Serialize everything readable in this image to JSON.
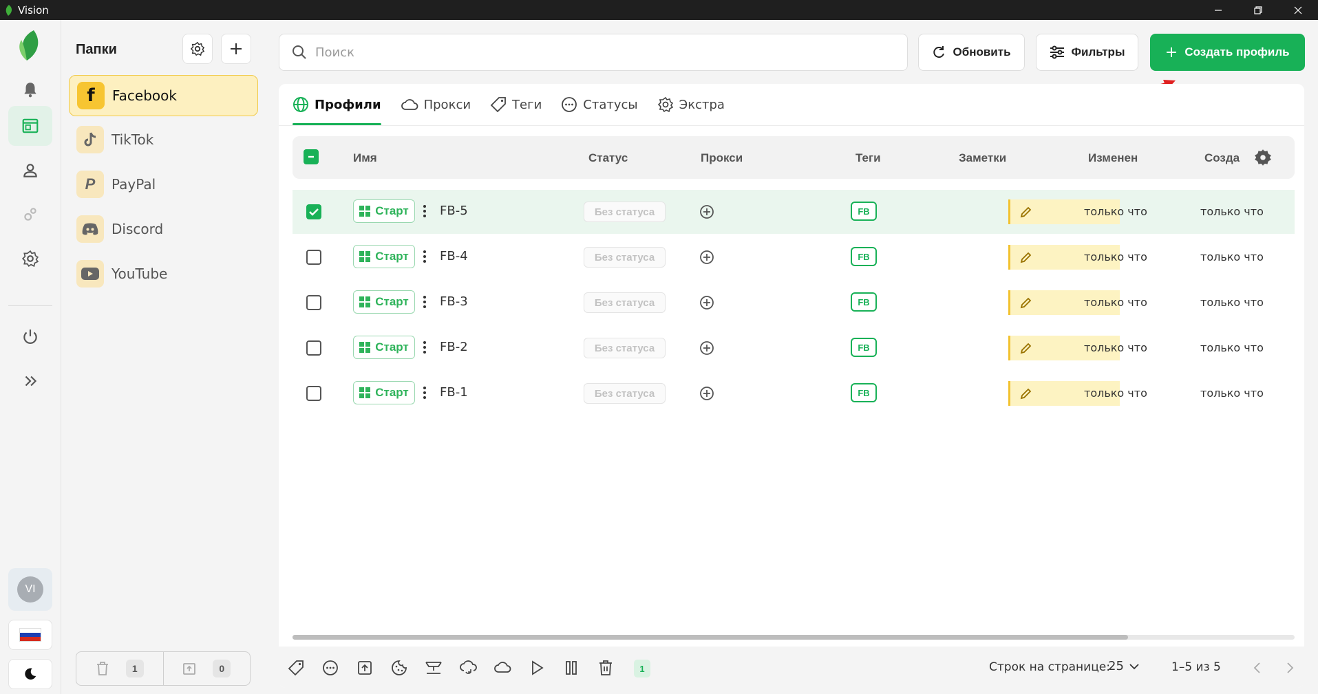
{
  "window": {
    "title": "Vision"
  },
  "folders": {
    "header": "Папки",
    "items": [
      {
        "label": "Facebook",
        "icon": "facebook-icon",
        "active": true
      },
      {
        "label": "TikTok",
        "icon": "tiktok-icon",
        "active": false
      },
      {
        "label": "PayPal",
        "icon": "paypal-icon",
        "active": false
      },
      {
        "label": "Discord",
        "icon": "discord-icon",
        "active": false
      },
      {
        "label": "YouTube",
        "icon": "youtube-icon",
        "active": false
      }
    ],
    "trash_count": "1",
    "archive_count": "0"
  },
  "user": {
    "initials": "VI"
  },
  "search": {
    "placeholder": "Поиск",
    "value": ""
  },
  "toolbar": {
    "refresh_label": "Обновить",
    "filters_label": "Фильтры",
    "create_label": "Создать профиль"
  },
  "tabs": [
    {
      "label": "Профили",
      "icon": "globe-icon",
      "active": true
    },
    {
      "label": "Прокси",
      "icon": "cloud-icon",
      "active": false
    },
    {
      "label": "Теги",
      "icon": "tag-icon",
      "active": false
    },
    {
      "label": "Статусы",
      "icon": "dots-circle-icon",
      "active": false
    },
    {
      "label": "Экстра",
      "icon": "gear-icon",
      "active": false
    }
  ],
  "table": {
    "columns": {
      "name": "Имя",
      "status": "Статус",
      "proxy": "Прокси",
      "tags": "Теги",
      "notes": "Заметки",
      "modified": "Изменен",
      "created": "Созда"
    },
    "rows": [
      {
        "name": "FB-5",
        "start_label": "Старт",
        "status": "Без статуса",
        "tag": "FB",
        "modified": "только что",
        "created": "только что",
        "selected": true
      },
      {
        "name": "FB-4",
        "start_label": "Старт",
        "status": "Без статуса",
        "tag": "FB",
        "modified": "только что",
        "created": "только что",
        "selected": false
      },
      {
        "name": "FB-3",
        "start_label": "Старт",
        "status": "Без статуса",
        "tag": "FB",
        "modified": "только что",
        "created": "только что",
        "selected": false
      },
      {
        "name": "FB-2",
        "start_label": "Старт",
        "status": "Без статуса",
        "tag": "FB",
        "modified": "только что",
        "created": "только что",
        "selected": false
      },
      {
        "name": "FB-1",
        "start_label": "Старт",
        "status": "Без статуса",
        "tag": "FB",
        "modified": "только что",
        "created": "только что",
        "selected": false
      }
    ]
  },
  "footer": {
    "selected_count": "1",
    "rows_per_page_label": "Строк на странице:",
    "rows_per_page": "25",
    "page_range": "1–5 из 5"
  },
  "colors": {
    "accent": "#18b157",
    "folder_active_bg": "#fdf0c0",
    "note_bg": "#fdf3c2",
    "annotation_arrow": "#e02020"
  }
}
